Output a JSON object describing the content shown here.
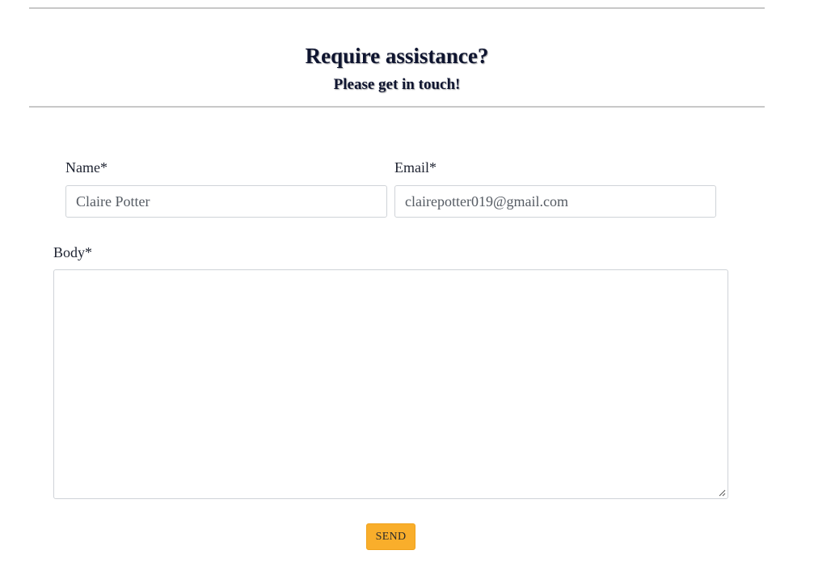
{
  "header": {
    "title": "Require assistance?",
    "subtitle": "Please get in touch!"
  },
  "form": {
    "name": {
      "label": "Name*",
      "value": "Claire Potter"
    },
    "email": {
      "label": "Email*",
      "value": "clairepotter019@gmail.com"
    },
    "body": {
      "label": "Body*",
      "value": ""
    },
    "submit_label": "SEND"
  },
  "colors": {
    "accent": "#f9ae2b",
    "heading": "#0f1530",
    "border": "#cfd3d8",
    "rule": "#c8c8c8"
  },
  "icons": {
    "resize_handle": "resize-grip-icon"
  }
}
